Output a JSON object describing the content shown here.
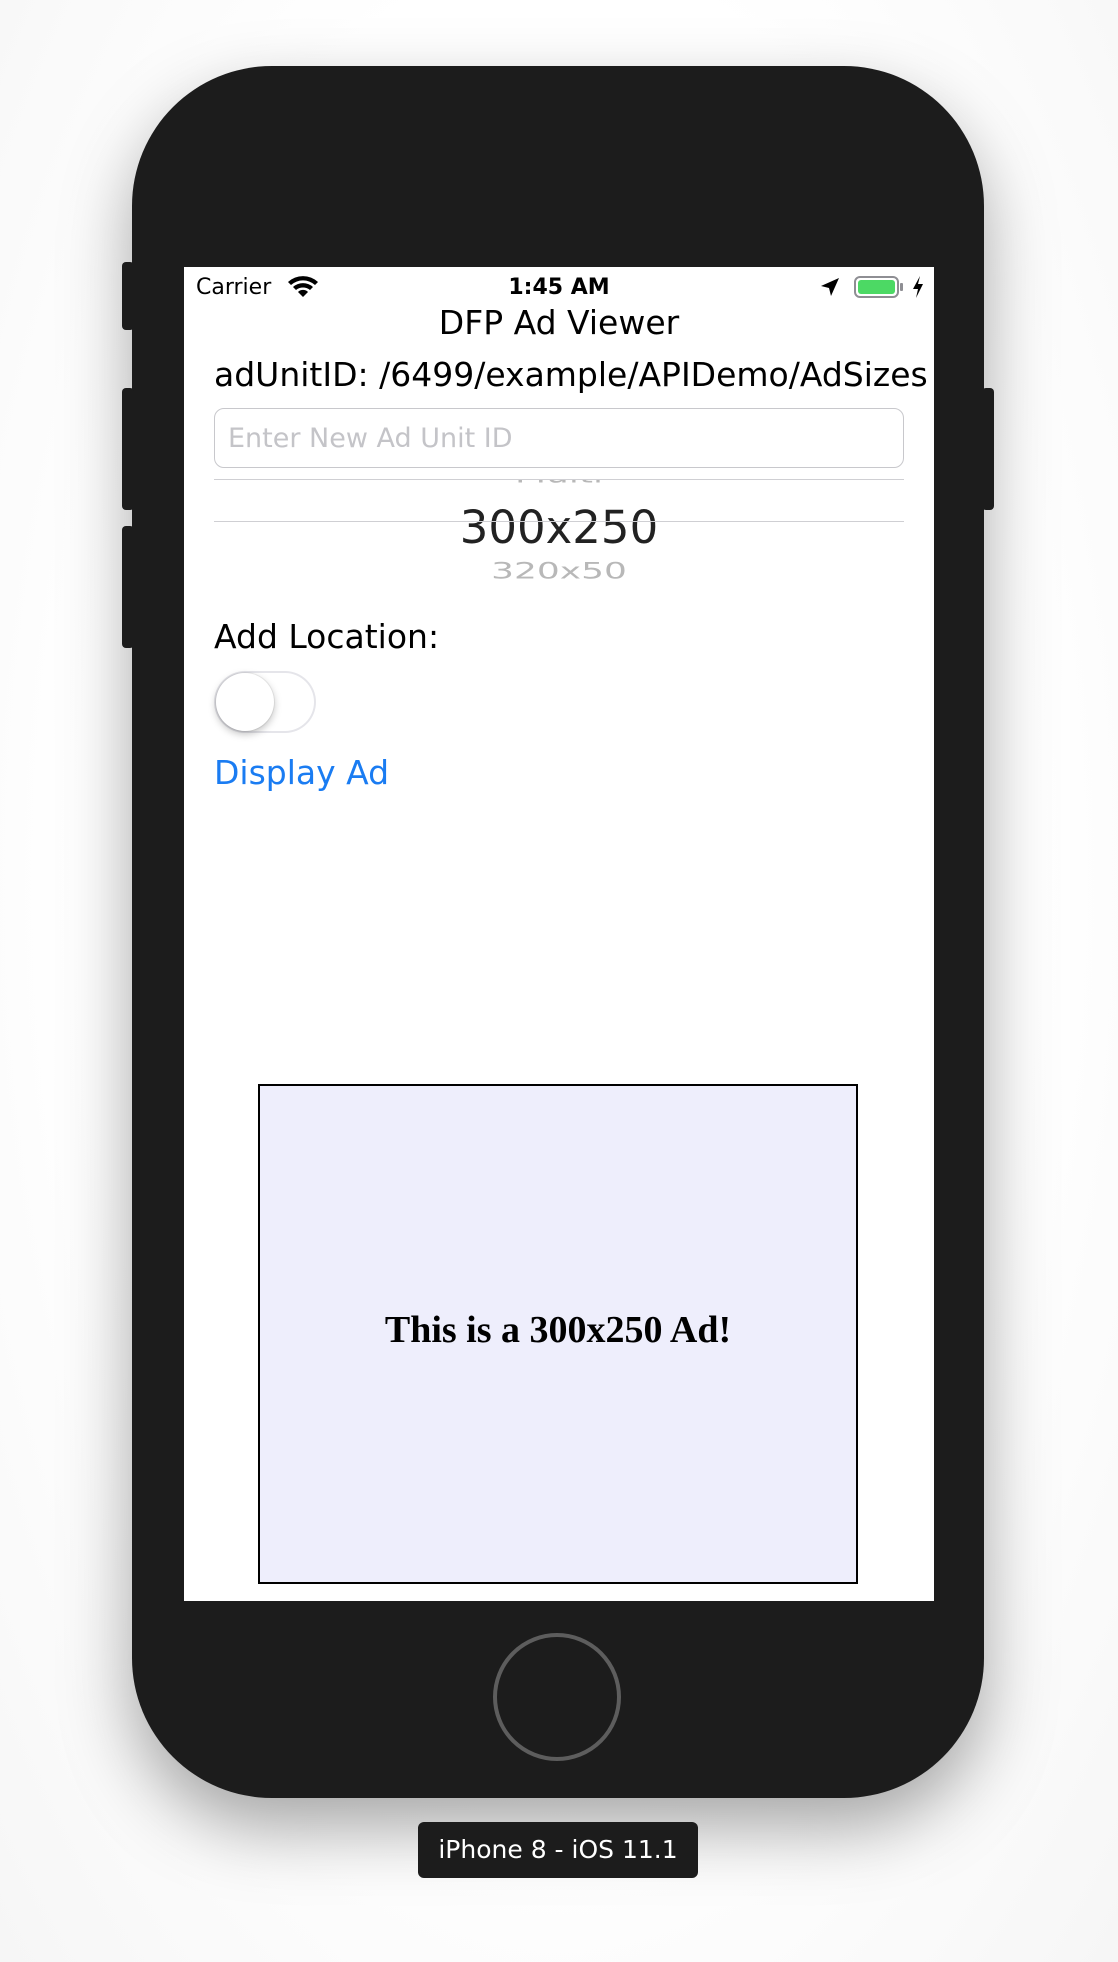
{
  "status_bar": {
    "carrier": "Carrier",
    "time": "1:45 AM",
    "battery_color": "#4cd964"
  },
  "nav": {
    "title": "DFP Ad Viewer"
  },
  "ad_unit": {
    "label": "adUnitID: /6499/example/APIDemo/AdSizes",
    "input_placeholder": "Enter New Ad Unit ID",
    "input_value": ""
  },
  "size_picker": {
    "previous_option": "Multi",
    "selected_option": "300x250",
    "next_option": "320x50"
  },
  "location": {
    "label": "Add Location:",
    "enabled": false
  },
  "actions": {
    "display_ad_label": "Display Ad",
    "accent_color": "#1a7cf2"
  },
  "ad": {
    "text": "This is a 300x250 Ad!",
    "background_color": "#eeeefc"
  },
  "simulator": {
    "device_label": "iPhone 8 - iOS 11.1"
  }
}
